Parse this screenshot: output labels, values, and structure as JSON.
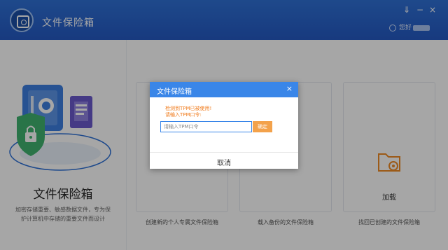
{
  "titlebar": {
    "app_title": "文件保险箱",
    "user_greeting": "您好",
    "window_buttons": {
      "menu": "⇓",
      "minimize": "−",
      "close": "×"
    }
  },
  "left_panel": {
    "title": "文件保险箱",
    "description": "加密存储重要、敏感数据文件，专为保护计算机中存储的重要文件而设计"
  },
  "cards": [
    {
      "description": "创建新的个人专属文件保险箱"
    },
    {
      "description": "载入备份的文件保险箱"
    },
    {
      "title": "加载",
      "description": "找回已创建的文件保险箱"
    }
  ],
  "dialog": {
    "title": "文件保险箱",
    "close_icon": "×",
    "warning_line1": "检测到TPM已被使用!",
    "warning_line2": "请输入TPM口令:",
    "input_placeholder": "请输入TPM口令",
    "ok_label": "确定",
    "cancel_label": "取消"
  },
  "colors": {
    "titlebar": "#2a66cf",
    "accent": "#3a86e8",
    "warning": "#f07a1a",
    "ok_button": "#f3a24b"
  }
}
